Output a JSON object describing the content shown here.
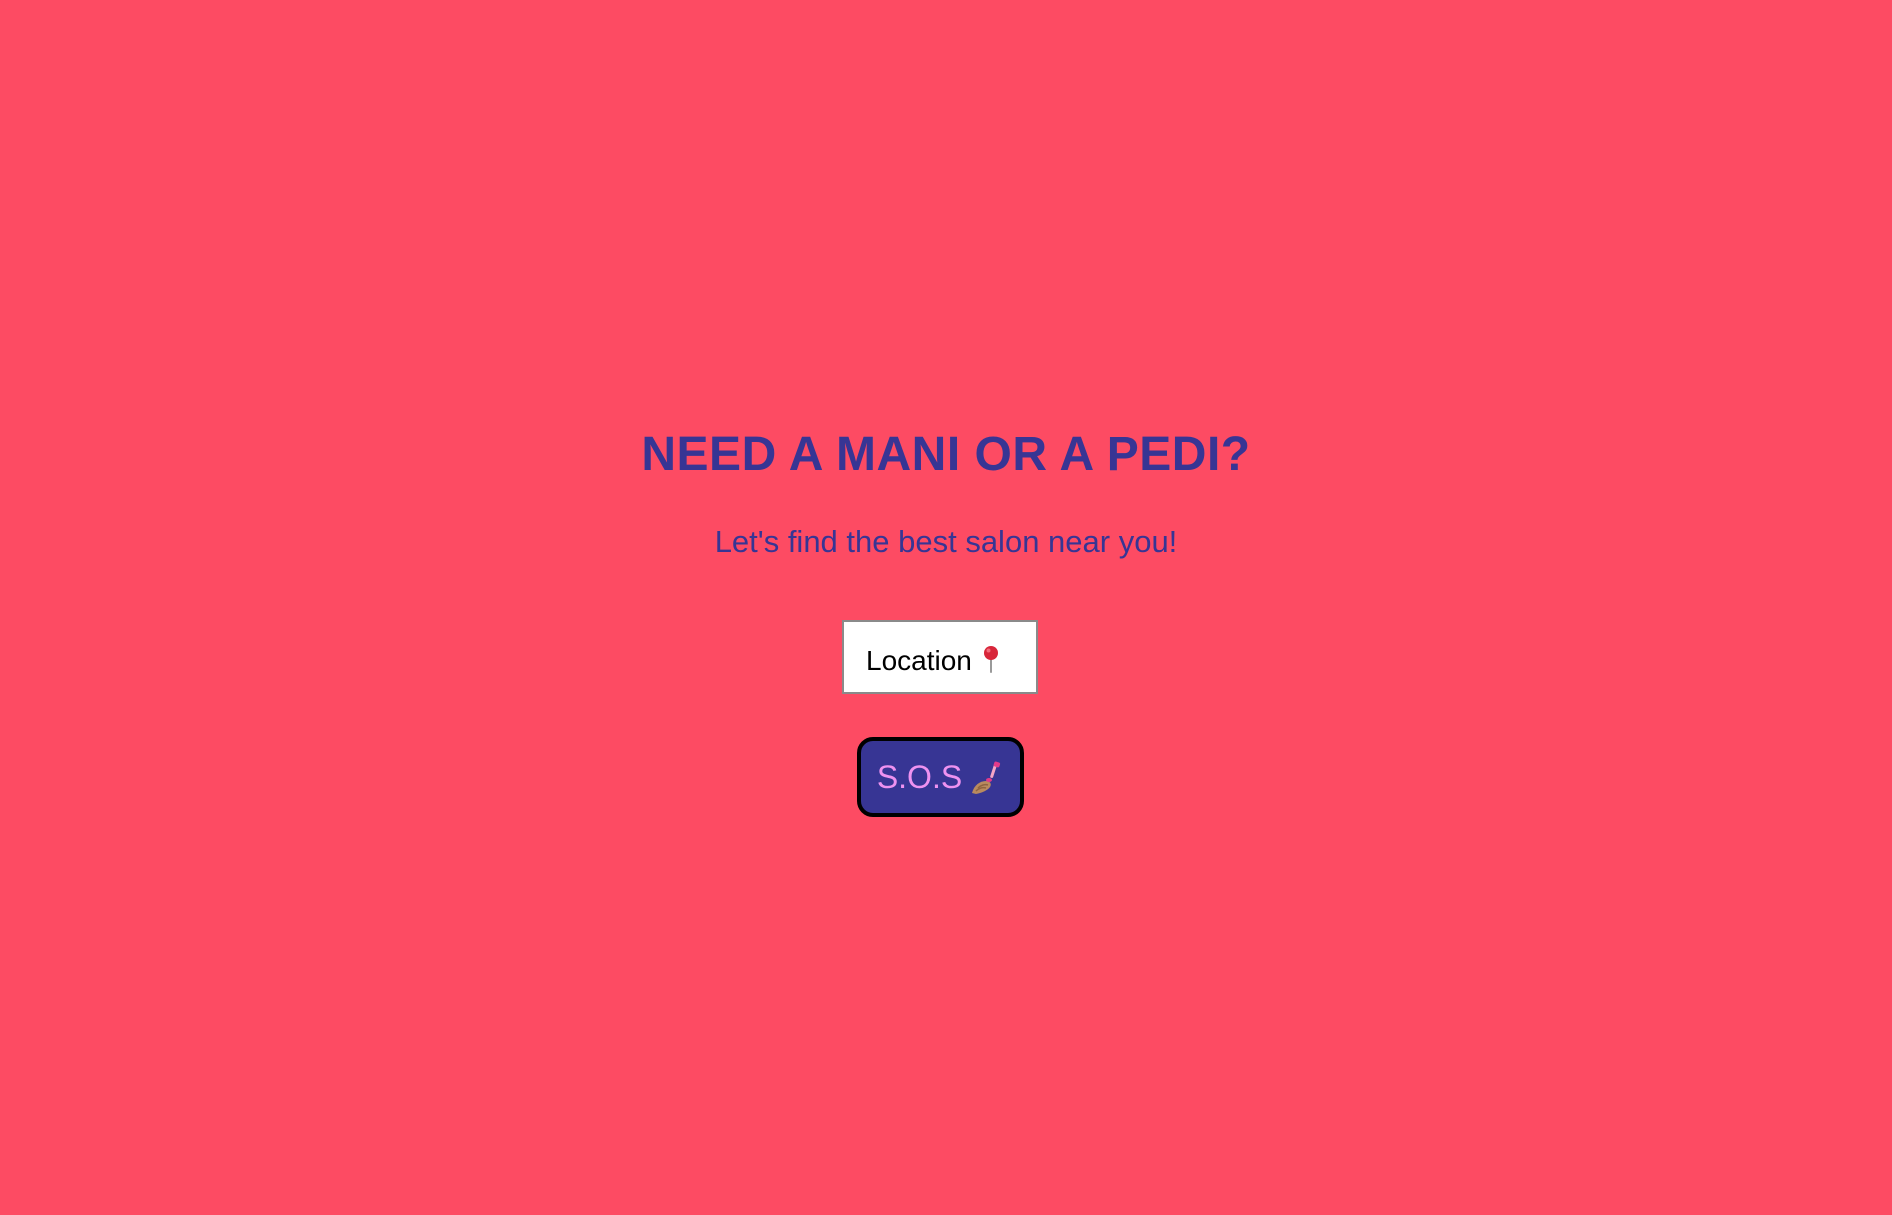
{
  "page": {
    "background_color": "#fd4b63"
  },
  "hero": {
    "title": "NEED A MANI OR A PEDI?",
    "subtitle": "Let's find the best salon near you!",
    "title_color": "#373594"
  },
  "location": {
    "label": "Location",
    "icon": "pushpin-icon"
  },
  "sos_button": {
    "label": "S.O.S",
    "icon": "nail-polish-icon",
    "background_color": "#373594",
    "text_color": "#ee92f0"
  }
}
